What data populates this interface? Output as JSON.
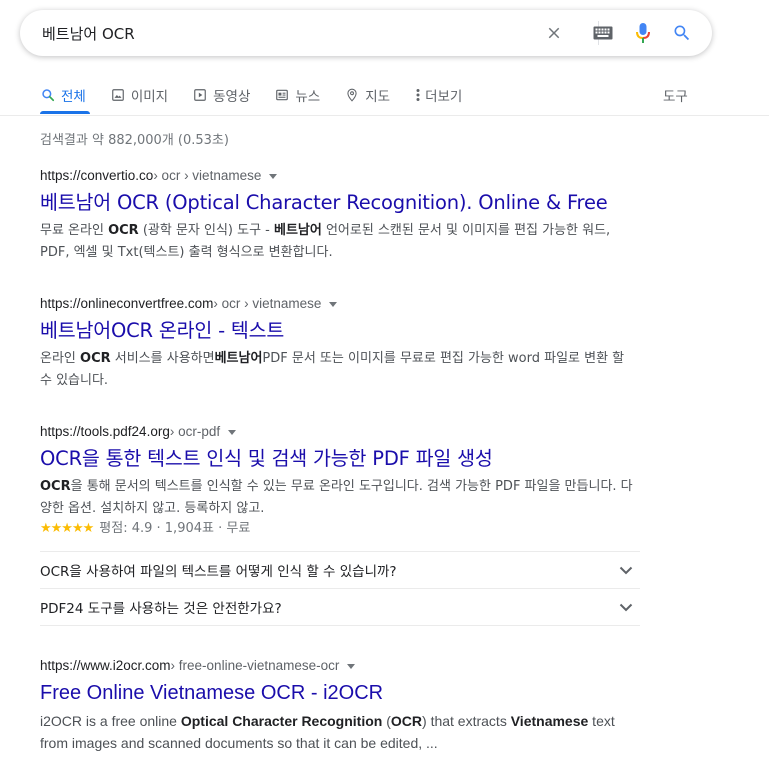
{
  "search": {
    "query": "베트남어 OCR",
    "icons": [
      "close-icon",
      "keyboard-icon",
      "microphone-icon",
      "search-icon"
    ]
  },
  "colors": {
    "accent": "#1a73e8",
    "link": "#1a0dab",
    "star": "#fbbc04",
    "mic_blue": "#4285f4",
    "mic_red": "#ea4335",
    "mic_yellow": "#fbbc04",
    "mic_green": "#34a853"
  },
  "tabs": [
    {
      "label": "전체",
      "icon": "search-icon",
      "active": true
    },
    {
      "label": "이미지",
      "icon": "image-icon"
    },
    {
      "label": "동영상",
      "icon": "video-icon"
    },
    {
      "label": "뉴스",
      "icon": "news-icon"
    },
    {
      "label": "지도",
      "icon": "location-pin-icon"
    },
    {
      "label": "더보기",
      "icon": "more-vert-icon"
    }
  ],
  "tools_label": "도구",
  "stats": "검색결과 약 882,000개 (0.53초)",
  "results": [
    {
      "domain": "https://convertio.co",
      "path": " › ocr › vietnamese",
      "title": "베트남어 OCR (Optical Character Recognition). Online & Free",
      "snippet": {
        "p1": "무료 온라인 ",
        "b1": "OCR",
        "p2": " (광학 문자 인식) 도구 - ",
        "b2": "베트남어",
        "p3": " 언어로된 스캔된 문서 및 이미지를 편집 가능한 워드, PDF, 엑셀 및 Txt(텍스트) 출력 형식으로 변환합니다."
      }
    },
    {
      "domain": "https://onlineconvertfree.com",
      "path": " › ocr › vietnamese",
      "title": "베트남어OCR 온라인 - 텍스트",
      "snippet": {
        "p1": "온라인 ",
        "b1": "OCR",
        "p2": " 서비스를 사용하면",
        "b2": "베트남어",
        "p3": "PDF 문서 또는 이미지를 무료로 편집 가능한 word 파일로 변환 할 수 있습니다."
      }
    },
    {
      "domain": "https://tools.pdf24.org",
      "path": " › ocr-pdf",
      "title": "OCR을 통한 텍스트 인식 및 검색 가능한 PDF 파일 생성",
      "snippet": {
        "b1": "OCR",
        "p1": "을 통해 문서의 텍스트를 인식할 수 있는 무료 온라인 도구입니다. 검색 가능한 PDF 파일을 만듭니다. 다양한 옵션. 설치하지 않고. 등록하지 않고."
      },
      "rating": {
        "stars": "★★★★★",
        "value": 4.9,
        "text": "평점: 4.9 · 1,904표 · 무료"
      },
      "faqs": [
        "OCR을 사용하여 파일의 텍스트를 어떻게 인식 할 수 있습니까?",
        "PDF24 도구를 사용하는 것은 안전한가요?"
      ]
    },
    {
      "domain": "https://www.i2ocr.com",
      "path": " › free-online-vietnamese-ocr",
      "title": "Free Online Vietnamese OCR - i2OCR",
      "snippet": {
        "p1": "i2OCR is a free online ",
        "b1": "Optical Character Recognition",
        "p2": " (",
        "b2": "OCR",
        "p3": ") that extracts ",
        "b3": "Vietnamese",
        "p4": " text from images and scanned documents so that it can be edited, ..."
      }
    }
  ]
}
